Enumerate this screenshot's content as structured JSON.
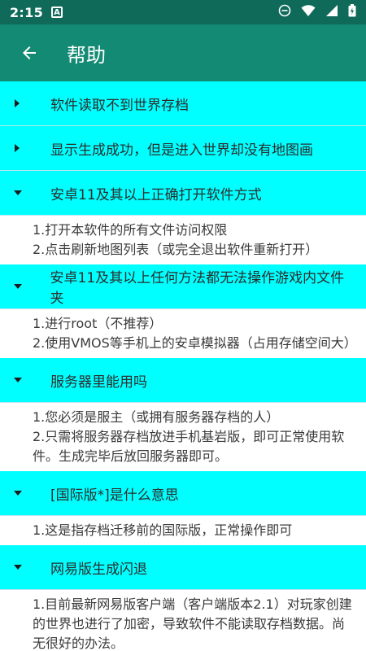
{
  "status": {
    "time": "2:15",
    "badge": "A"
  },
  "appbar": {
    "title": "帮助"
  },
  "items": [
    {
      "label": "软件读取不到世界存档",
      "expanded": false,
      "lines": []
    },
    {
      "label": "显示生成成功，但是进入世界却没有地图画",
      "expanded": false,
      "lines": []
    },
    {
      "label": "安卓11及其以上正确打开软件方式",
      "expanded": true,
      "lines": [
        "1.打开本软件的所有文件访问权限",
        "2.点击刷新地图列表（或完全退出软件重新打开）"
      ]
    },
    {
      "label": "安卓11及其以上任何方法都无法操作游戏内文件夹",
      "expanded": true,
      "lines": [
        "1.进行root（不推荐）",
        "2.使用VMOS等手机上的安卓模拟器（占用存储空间大）"
      ]
    },
    {
      "label": "服务器里能用吗",
      "expanded": true,
      "lines": [
        "1.您必须是服主（或拥有服务器存档的人）",
        "2.只需将服务器存档放进手机基岩版，即可正常使用软件。生成完毕后放回服务器即可。"
      ]
    },
    {
      "label": "[国际版*]是什么意思",
      "expanded": true,
      "lines": [
        "1.这是指存档迁移前的国际版，正常操作即可"
      ]
    },
    {
      "label": "网易版生成闪退",
      "expanded": true,
      "lines": [
        "1.目前最新网易版客户端（客户端版本2.1）对玩家创建的世界也进行了加密，导致软件不能读取存档数据。尚无很好的办法。"
      ]
    }
  ]
}
